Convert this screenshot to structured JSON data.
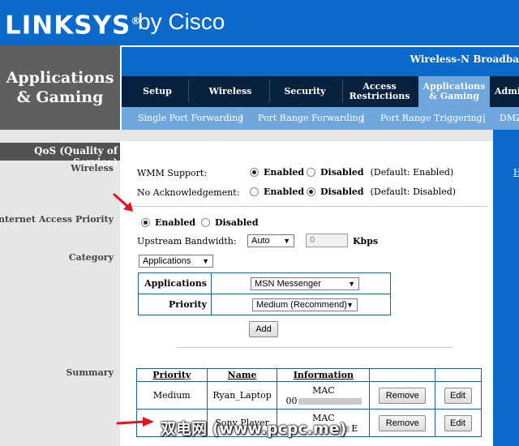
{
  "brand": {
    "logo": "LINKSYS",
    "logo_mark": "®",
    "by": "by Cisco"
  },
  "section_title": "Applications & Gaming",
  "product_name": "Wireless-N Broadba",
  "tabs": [
    {
      "label": "Setup"
    },
    {
      "label": "Wireless"
    },
    {
      "label": "Security"
    },
    {
      "label": "Access Restrictions"
    },
    {
      "label": "Applications & Gaming",
      "active": true
    },
    {
      "label": "Admi"
    }
  ],
  "subtabs": [
    "Single Port Forwarding",
    "Port Range Forwarding",
    "Port Range Triggering",
    "DMZ"
  ],
  "subtab_separator": "|",
  "qos_title": "QoS (Quality of Service)",
  "left_labels": {
    "wireless": "Wireless",
    "internet_access_priority": "Internet Access Priority",
    "category": "Category",
    "summary": "Summary"
  },
  "right_link": "H",
  "wireless": {
    "wmm_label": "WMM Support:",
    "wmm_enabled": "Enabled",
    "wmm_disabled": "Disabled",
    "wmm_default": "(Default: Enabled)",
    "noack_label": "No Acknowledgement:",
    "noack_enabled": "Enabled",
    "noack_disabled": "Disabled",
    "noack_default": "(Default: Disabled)"
  },
  "iap": {
    "enabled": "Enabled",
    "disabled": "Disabled",
    "upstream_label": "Upstream Bandwidth:",
    "upstream_mode": "Auto",
    "upstream_value": "0",
    "unit": "Kbps"
  },
  "category": {
    "selected": "Applications",
    "row1_label": "Applications",
    "row1_value": "MSN Messenger",
    "row2_label": "Priority",
    "row2_value": "Medium (Recommend)",
    "add_button": "Add"
  },
  "summary": {
    "headers": [
      "Priority",
      "Name",
      "Information"
    ],
    "rows": [
      {
        "priority": "Medium",
        "name": "Ryan_Laptop",
        "info_title": "MAC",
        "info_value": "00",
        "remove": "Remove",
        "edit": "Edit"
      },
      {
        "priority": "",
        "name": "Sony Player",
        "info_title": "MAC",
        "info_value": "E",
        "remove": "Remove",
        "edit": "Edit"
      }
    ]
  },
  "watermark": "双电网 (www.pcpc.me)",
  "colors": {
    "brand_blue": "#0a69c9",
    "tab_dark": "#08213f",
    "tab_active": "#6fa7dc",
    "section_gray": "#5f5f5f",
    "annotation_red": "#e0141e"
  }
}
